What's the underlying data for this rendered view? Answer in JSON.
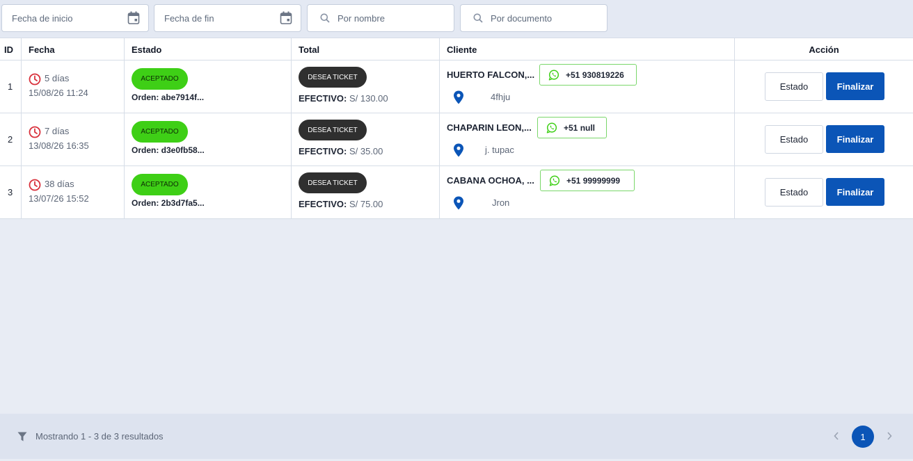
{
  "filters": {
    "start_date_placeholder": "Fecha de inicio",
    "end_date_placeholder": "Fecha de fin",
    "name_placeholder": "Por nombre",
    "document_placeholder": "Por documento"
  },
  "table": {
    "headers": {
      "id": "ID",
      "fecha": "Fecha",
      "estado": "Estado",
      "total": "Total",
      "cliente": "Cliente",
      "accion": "Acción"
    },
    "rows": [
      {
        "id": "1",
        "elapsed": "5 días",
        "datetime": "15/08/26 11:24",
        "status": "ACEPTADO",
        "order": "Orden: abe7914f...",
        "ticket": "DESEA TICKET",
        "payment_method": "EFECTIVO:",
        "amount": "S/ 130.00",
        "client": "HUERTO FALCON,...",
        "phone": "+51 930819226",
        "address": "4fhju"
      },
      {
        "id": "2",
        "elapsed": "7 días",
        "datetime": "13/08/26 16:35",
        "status": "ACEPTADO",
        "order": "Orden: d3e0fb58...",
        "ticket": "DESEA TICKET",
        "payment_method": "EFECTIVO:",
        "amount": "S/ 35.00",
        "client": "CHAPARIN LEON,...",
        "phone": "+51 null",
        "address": "j. tupac"
      },
      {
        "id": "3",
        "elapsed": "38 días",
        "datetime": "13/07/26 15:52",
        "status": "ACEPTADO",
        "order": "Orden: 2b3d7fa5...",
        "ticket": "DESEA TICKET",
        "payment_method": "EFECTIVO:",
        "amount": "S/ 75.00",
        "client": "CABANA OCHOA, ...",
        "phone": "+51 99999999",
        "address": "Jron"
      }
    ],
    "actions": {
      "estado_label": "Estado",
      "finalizar_label": "Finalizar"
    }
  },
  "footer": {
    "summary": "Mostrando 1 - 3 de 3 resultados",
    "current_page": "1"
  },
  "colors": {
    "primary": "#0b55b7",
    "accepted": "#3ecf16",
    "ticket": "#2f2f2f",
    "clock": "#d9323d",
    "whatsapp": "#3ecf16"
  },
  "icons": [
    "calendar-icon",
    "search-icon",
    "clock-icon",
    "whatsapp-icon",
    "location-pin-icon",
    "filter-icon",
    "chevron-left-icon",
    "chevron-right-icon"
  ]
}
